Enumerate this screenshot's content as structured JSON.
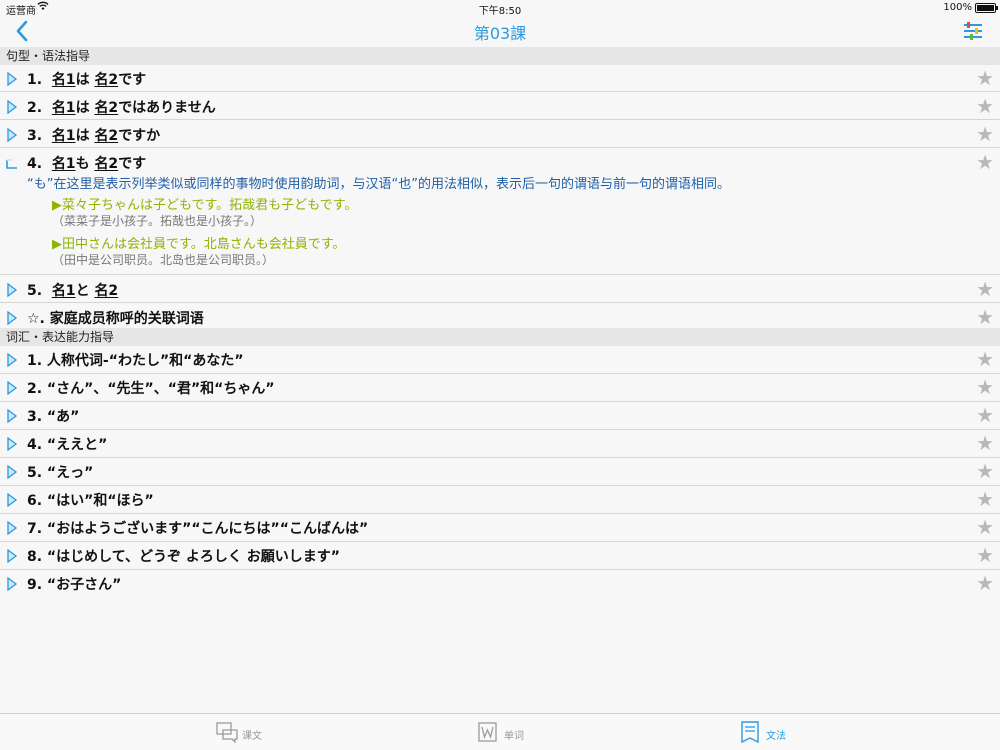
{
  "status": {
    "carrier": "运营商",
    "time": "下午8:50",
    "battery": "100%"
  },
  "nav": {
    "title": "第03課"
  },
  "sections": {
    "grammar": "句型・语法指导",
    "vocab": "词汇・表达能力指导"
  },
  "grammar": {
    "i1": {
      "num": "1.",
      "a": "名1",
      "b": "は",
      "c": "名2",
      "d": "です"
    },
    "i2": {
      "num": "2.",
      "a": "名1",
      "b": "は",
      "c": "名2",
      "d": "ではありません"
    },
    "i3": {
      "num": "3.",
      "a": "名1",
      "b": "は",
      "c": "名2",
      "d": "ですか"
    },
    "i4": {
      "num": "4.",
      "a": "名1",
      "b": "も",
      "c": "名2",
      "d": "です",
      "explanation": "“も”在这里是表示列举类似或同样的事物时使用韵助词，与汉语“也”的用法相似，表示后一句的谓语与前一句的谓语相同。",
      "ex1_jp": "▶菜々子ちゃんは子どもです。拓哉君も子どもです。",
      "ex1_cn": "（菜菜子是小孩子。拓哉也是小孩子。）",
      "ex2_jp": "▶田中さんは会社員です。北島さんも会社員です。",
      "ex2_cn": "（田中是公司职员。北岛也是公司职员。）"
    },
    "i5": {
      "num": "5.",
      "a": "名1",
      "b": "と",
      "c": "名2"
    },
    "i6": {
      "text": "☆.  家庭成员称呼的关联词语"
    }
  },
  "vocab": [
    "1.  人称代词-“わたし”和“あなた”",
    "2.  “さん”、“先生”、“君”和“ちゃん”",
    "3.  “あ”",
    "4.  “ええと”",
    "5.  “えっ”",
    "6.  “はい”和“ほら”",
    "7.  “おはようございます”“こんにちは”“こんばんは”",
    "8.  “はじめして、どうぞ よろしく お願いします”",
    "9.  “お子さん”"
  ],
  "icons": {
    "star": "★",
    "arrow_color": "#2a9be3"
  },
  "tabs": {
    "text": "课文",
    "words": "单词",
    "grammar": "文法"
  }
}
